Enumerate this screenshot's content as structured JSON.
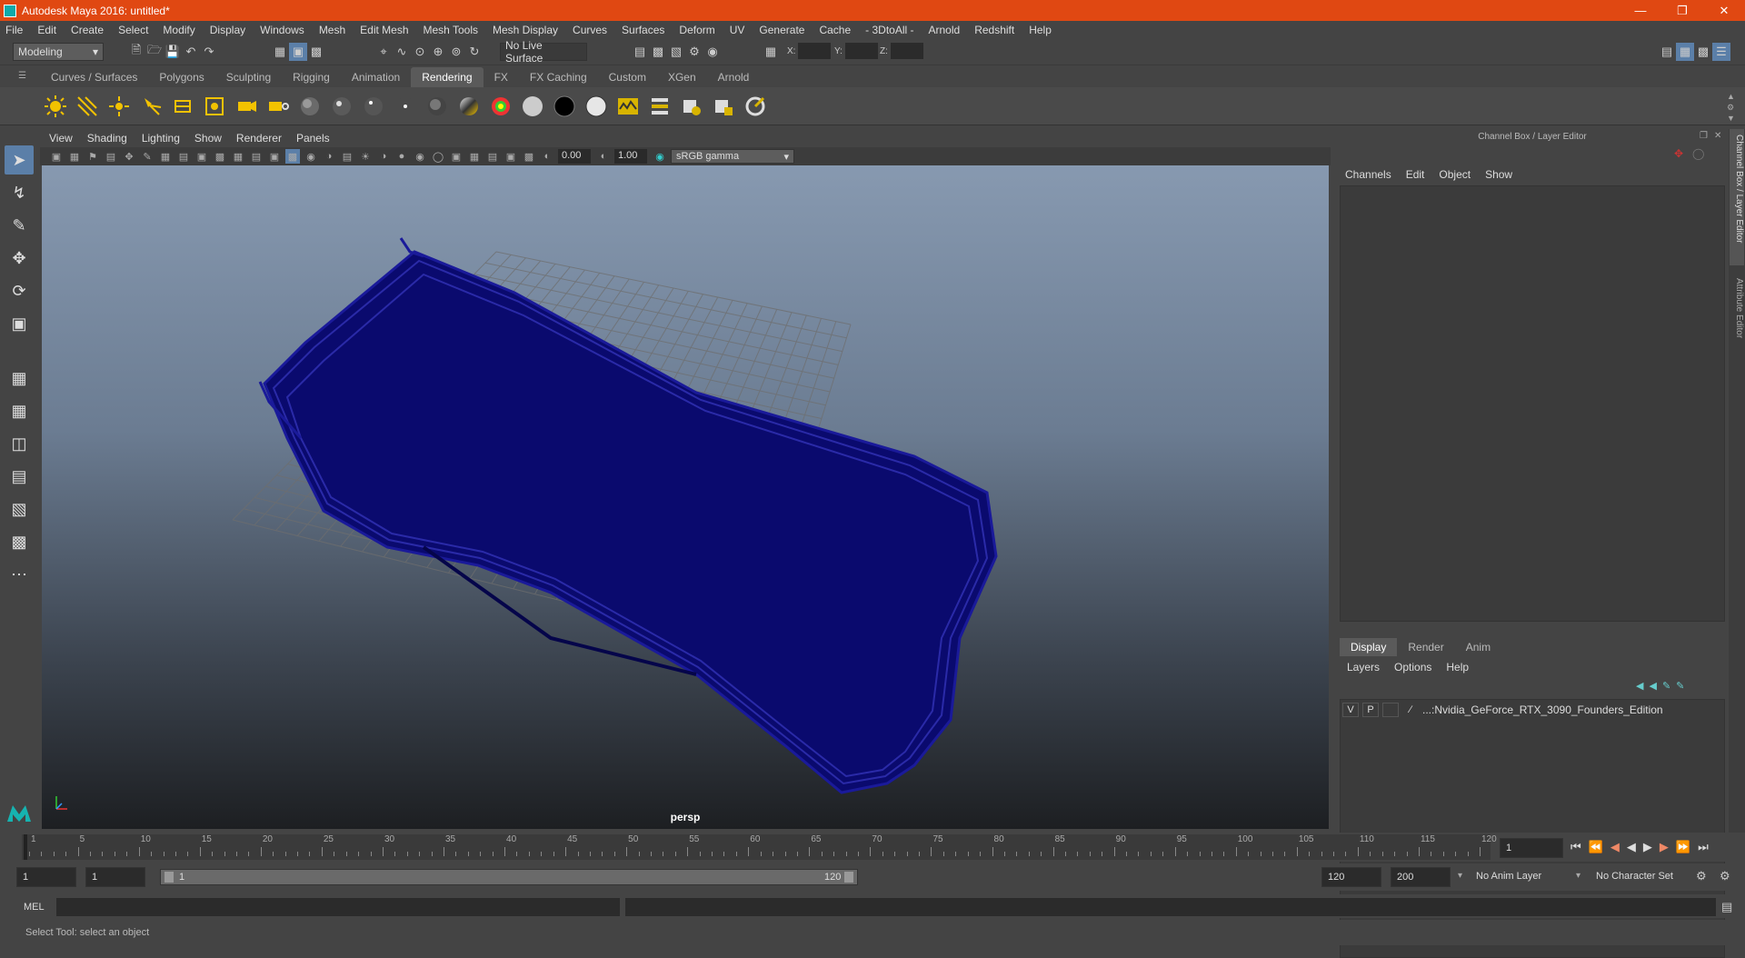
{
  "window": {
    "title": "Autodesk Maya 2016: untitled*",
    "minimize_icon": "minimize-icon",
    "maximize_icon": "restore-icon",
    "close_icon": "close-icon"
  },
  "menubar": [
    "File",
    "Edit",
    "Create",
    "Select",
    "Modify",
    "Display",
    "Windows",
    "Mesh",
    "Edit Mesh",
    "Mesh Tools",
    "Mesh Display",
    "Curves",
    "Surfaces",
    "Deform",
    "UV",
    "Generate",
    "Cache",
    "- 3DtoAll -",
    "Arnold",
    "Redshift",
    "Help"
  ],
  "statusline": {
    "mode": "Modeling",
    "live_surface": "No Live Surface",
    "x_label": "X:",
    "y_label": "Y:",
    "z_label": "Z:"
  },
  "shelf_tabs": [
    "Curves / Surfaces",
    "Polygons",
    "Sculpting",
    "Rigging",
    "Animation",
    "Rendering",
    "FX",
    "FX Caching",
    "Custom",
    "XGen",
    "Arnold"
  ],
  "active_shelf": "Rendering",
  "viewport": {
    "menu": [
      "View",
      "Shading",
      "Lighting",
      "Show",
      "Renderer",
      "Panels"
    ],
    "exposure": "0.00",
    "gamma": "1.00",
    "color_space": "sRGB gamma",
    "camera_label": "persp"
  },
  "channel_box": {
    "title": "Channel Box / Layer Editor",
    "menu": [
      "Channels",
      "Edit",
      "Object",
      "Show"
    ],
    "layer_tabs": [
      "Display",
      "Render",
      "Anim"
    ],
    "active_layer_tab": "Display",
    "layer_menu": [
      "Layers",
      "Options",
      "Help"
    ],
    "layer": {
      "v": "V",
      "p": "P",
      "name": "...:Nvidia_GeForce_RTX_3090_Founders_Edition"
    }
  },
  "side_tabs": [
    "Channel Box / Layer Editor",
    "Attribute Editor"
  ],
  "timeslider": {
    "ticks": [
      1,
      5,
      10,
      15,
      20,
      25,
      30,
      35,
      40,
      45,
      50,
      55,
      60,
      65,
      70,
      75,
      80,
      85,
      90,
      95,
      100,
      105,
      110,
      115,
      120
    ],
    "current_frame": "1"
  },
  "range": {
    "start": "1",
    "anim_start": "1",
    "range_start_label": "1",
    "range_end_label": "120",
    "end": "120",
    "anim_end": "200",
    "anim_layer": "No Anim Layer",
    "character_set": "No Character Set"
  },
  "command_line": {
    "label": "MEL"
  },
  "help_line": "Select Tool: select an object",
  "colors": {
    "title_bar": "#e04812",
    "wireframe": "#0a0a6e",
    "selected_tool": "#5b7fa8"
  }
}
